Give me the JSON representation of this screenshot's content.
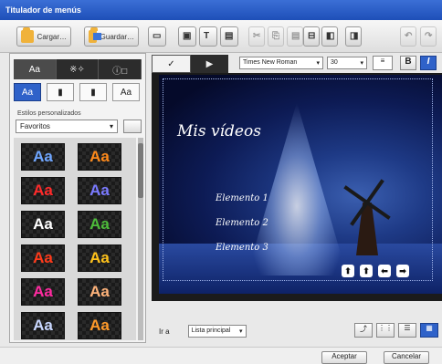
{
  "window": {
    "title": "Titulador de menús"
  },
  "toolbar": {
    "open_label": "Cargar…",
    "save_label": "Guardar…"
  },
  "left_panel": {
    "tabs": [
      "Aa",
      "※✧",
      "ⓘ□"
    ],
    "style_buttons": [
      "Aa",
      "▮",
      "▮",
      "Aa"
    ],
    "preset_label": "Estilos personalizados",
    "preset_value": "Favoritos",
    "swatches": [
      {
        "text": "Aa",
        "color": "#6fa6ff"
      },
      {
        "text": "Aa",
        "color": "#ff8a1a"
      },
      {
        "text": "Aa",
        "color": "#ff2a2a"
      },
      {
        "text": "Aa",
        "color": "#7a7aff"
      },
      {
        "text": "Aa",
        "color": "#ffffff"
      },
      {
        "text": "Aa",
        "color": "#4dbb3a"
      },
      {
        "text": "Aa",
        "color": "#ff3a1a"
      },
      {
        "text": "Aa",
        "color": "#ffc21a"
      },
      {
        "text": "Aa",
        "color": "#ff2aa0"
      },
      {
        "text": "Aa",
        "color": "#ffb37a"
      },
      {
        "text": "Aa",
        "color": "#c9d7ff"
      },
      {
        "text": "Aa",
        "color": "#ff9a2a"
      }
    ]
  },
  "editor": {
    "tabs": [
      "✓",
      "▶"
    ],
    "font": "Times New Roman",
    "size": "30",
    "align": "≡",
    "bold": "B",
    "italic": "I"
  },
  "canvas": {
    "title": "Mis vídeos",
    "elements": [
      "Elemento 1",
      "Elemento 2",
      "Elemento 3"
    ],
    "nav": [
      "⬆",
      "⬆",
      "⬅",
      "➡"
    ]
  },
  "bottom": {
    "label": "Ir a",
    "select_value": "Lista principal",
    "icons": [
      "⤴",
      "⋮⋮",
      "☰",
      "▦"
    ]
  },
  "footer": {
    "ok_label": "Aceptar",
    "cancel_label": "Cancelar"
  }
}
